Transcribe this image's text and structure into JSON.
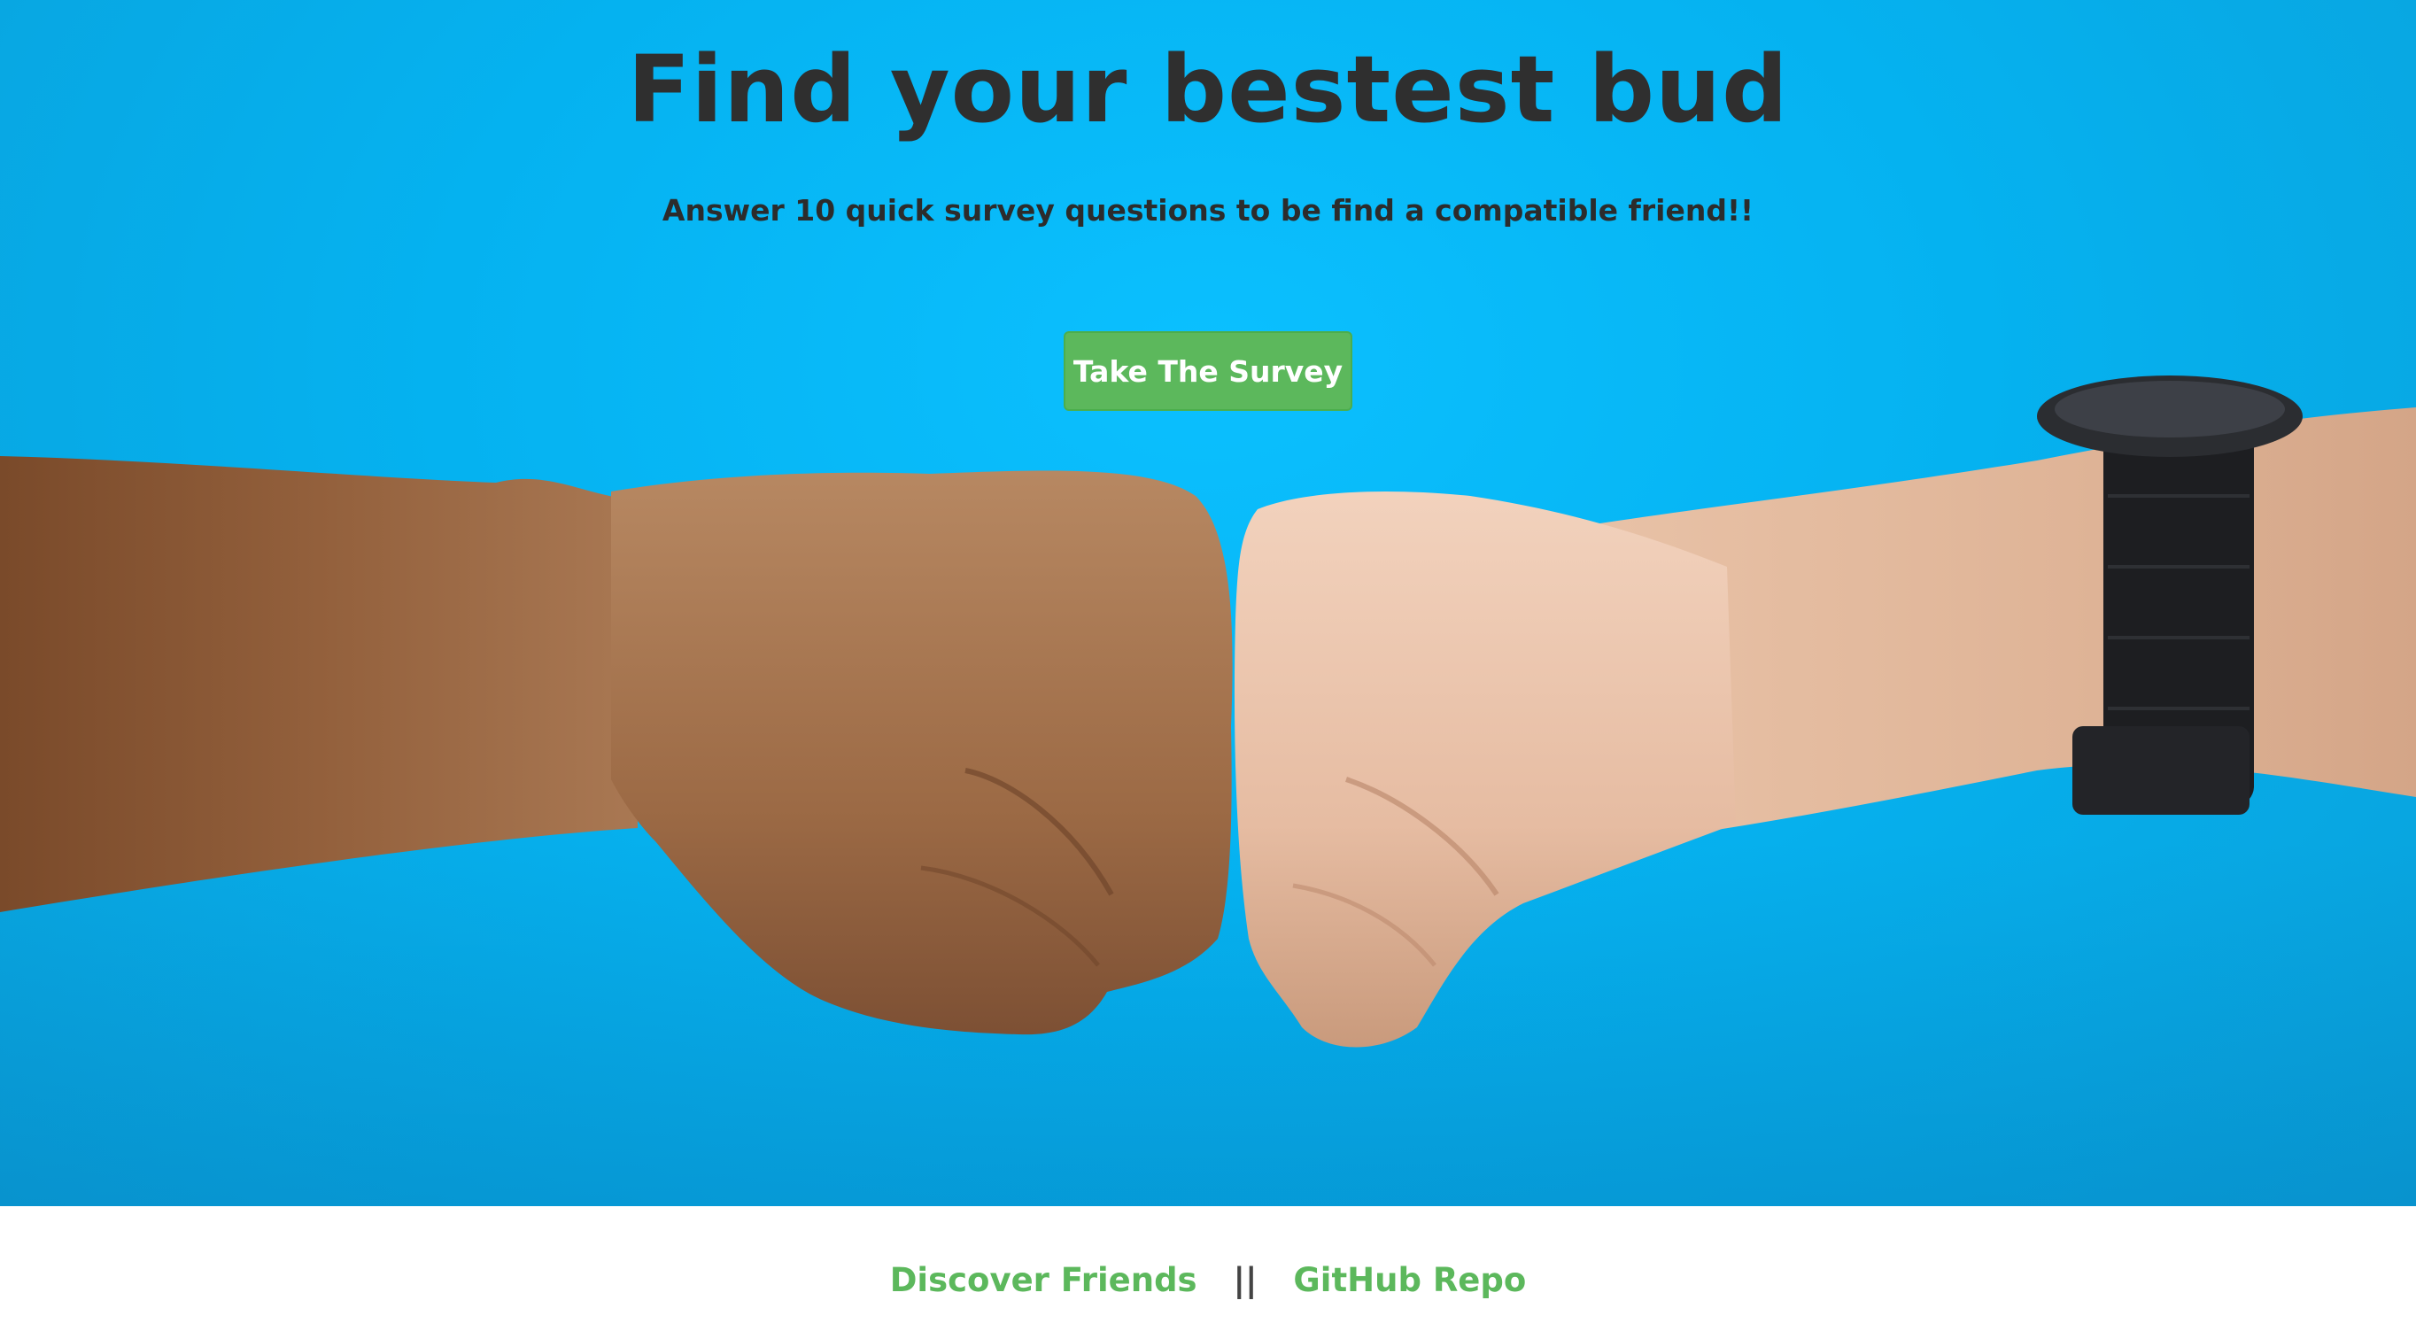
{
  "hero": {
    "title": "Find your bestest bud",
    "subtitle": "Answer 10 quick survey questions to be find a compatible friend!!",
    "survey_button_label": "Take The Survey"
  },
  "footer": {
    "links": [
      {
        "label": "Discover Friends"
      },
      {
        "label": "GitHub Repo"
      }
    ],
    "separator": "||"
  },
  "colors": {
    "hero_background": "#05b2f0",
    "accent_green": "#5cb85c",
    "title_text": "#2f2f2f"
  }
}
